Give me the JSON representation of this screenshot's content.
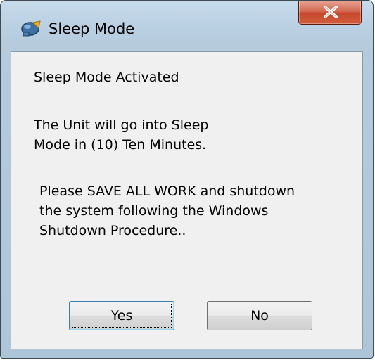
{
  "window": {
    "title": "Sleep Mode",
    "close_glyph": "X"
  },
  "message": {
    "line1": "Sleep Mode Activated",
    "line2": "The Unit will go into Sleep\nMode in (10) Ten Minutes.",
    "line3": "Please SAVE ALL WORK and shutdown\nthe system following the Windows\nShutdown Procedure.."
  },
  "buttons": {
    "yes": {
      "mnemonic": "Y",
      "rest": "es"
    },
    "no": {
      "mnemonic": "N",
      "rest": "o"
    }
  },
  "icons": {
    "app": "sleep-app-icon",
    "close": "close-icon"
  },
  "colors": {
    "title_bar": "#b9cfe2",
    "close_button": "#c7472d",
    "client_bg": "#f0f0f0",
    "default_button_border": "#3c7fb1"
  }
}
